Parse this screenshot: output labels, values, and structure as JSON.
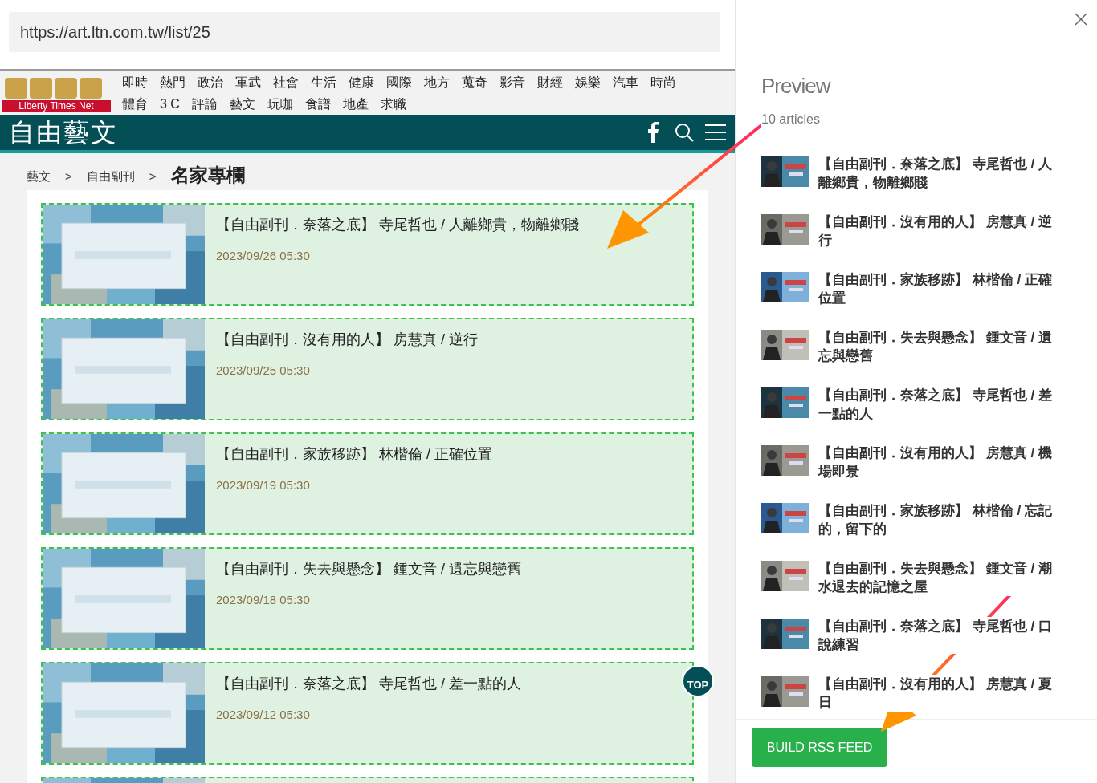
{
  "url_field": {
    "value": "https://art.ltn.com.tw/list/25"
  },
  "site": {
    "logo_caption": "Liberty Times Net",
    "nav_rows": [
      [
        "即時",
        "熱門",
        "政治",
        "軍武",
        "社會",
        "生活",
        "健康",
        "國際",
        "地方",
        "蒐奇",
        "影音",
        "財經",
        "娛樂",
        "汽車",
        "時尚"
      ],
      [
        "體育",
        "3 C",
        "評論",
        "藝文",
        "玩咖",
        "食譜",
        "地產",
        "求職"
      ]
    ],
    "section_title": "自由藝文"
  },
  "breadcrumb": [
    "藝文",
    "自由副刊"
  ],
  "breadcrumb_separator": ">",
  "page_heading": "名家專欄",
  "articles": [
    {
      "kind": "article",
      "title": "【自由副刊．奈落之底】 寺尾哲也 / 人離鄉貴，物離鄉賤",
      "date": "2023/09/26 05:30",
      "highlighted": true
    },
    {
      "kind": "article",
      "title": "【自由副刊．沒有用的人】 房慧真 / 逆行",
      "date": "2023/09/25 05:30",
      "highlighted": true
    },
    {
      "kind": "article",
      "title": "【自由副刊．家族移跡】 林楷倫 / 正確位置",
      "date": "2023/09/19 05:30",
      "highlighted": true
    },
    {
      "kind": "article",
      "title": "【自由副刊．失去與懸念】 鍾文音 / 遺忘與戀舊",
      "date": "2023/09/18 05:30",
      "highlighted": true
    },
    {
      "kind": "article",
      "title": "【自由副刊．奈落之底】 寺尾哲也 / 差一點的人",
      "date": "2023/09/12 05:30",
      "highlighted": true
    },
    {
      "kind": "picture",
      "highlighted": true
    }
  ],
  "top_button": {
    "label": "TOP"
  },
  "preview": {
    "title": "Preview",
    "count": "10 articles",
    "items": [
      {
        "title": "【自由副刊．奈落之底】 寺尾哲也 / 人離鄉貴，物離鄉賤"
      },
      {
        "title": "【自由副刊．沒有用的人】 房慧真 / 逆行"
      },
      {
        "title": "【自由副刊．家族移跡】 林楷倫 / 正確位置"
      },
      {
        "title": "【自由副刊．失去與懸念】 鍾文音 / 遺忘與戀舊"
      },
      {
        "title": "【自由副刊．奈落之底】 寺尾哲也 / 差一點的人"
      },
      {
        "title": "【自由副刊．沒有用的人】 房慧真 / 機場即景"
      },
      {
        "title": "【自由副刊．家族移跡】 林楷倫 / 忘記的，留下的"
      },
      {
        "title": "【自由副刊．失去與懸念】 鍾文音 / 潮水退去的記憶之屋"
      },
      {
        "title": "【自由副刊．奈落之底】 寺尾哲也 / 口說練習"
      },
      {
        "title": "【自由副刊．沒有用的人】 房慧真 / 夏日"
      }
    ]
  },
  "build_button": {
    "label": "BUILD RSS FEED"
  }
}
